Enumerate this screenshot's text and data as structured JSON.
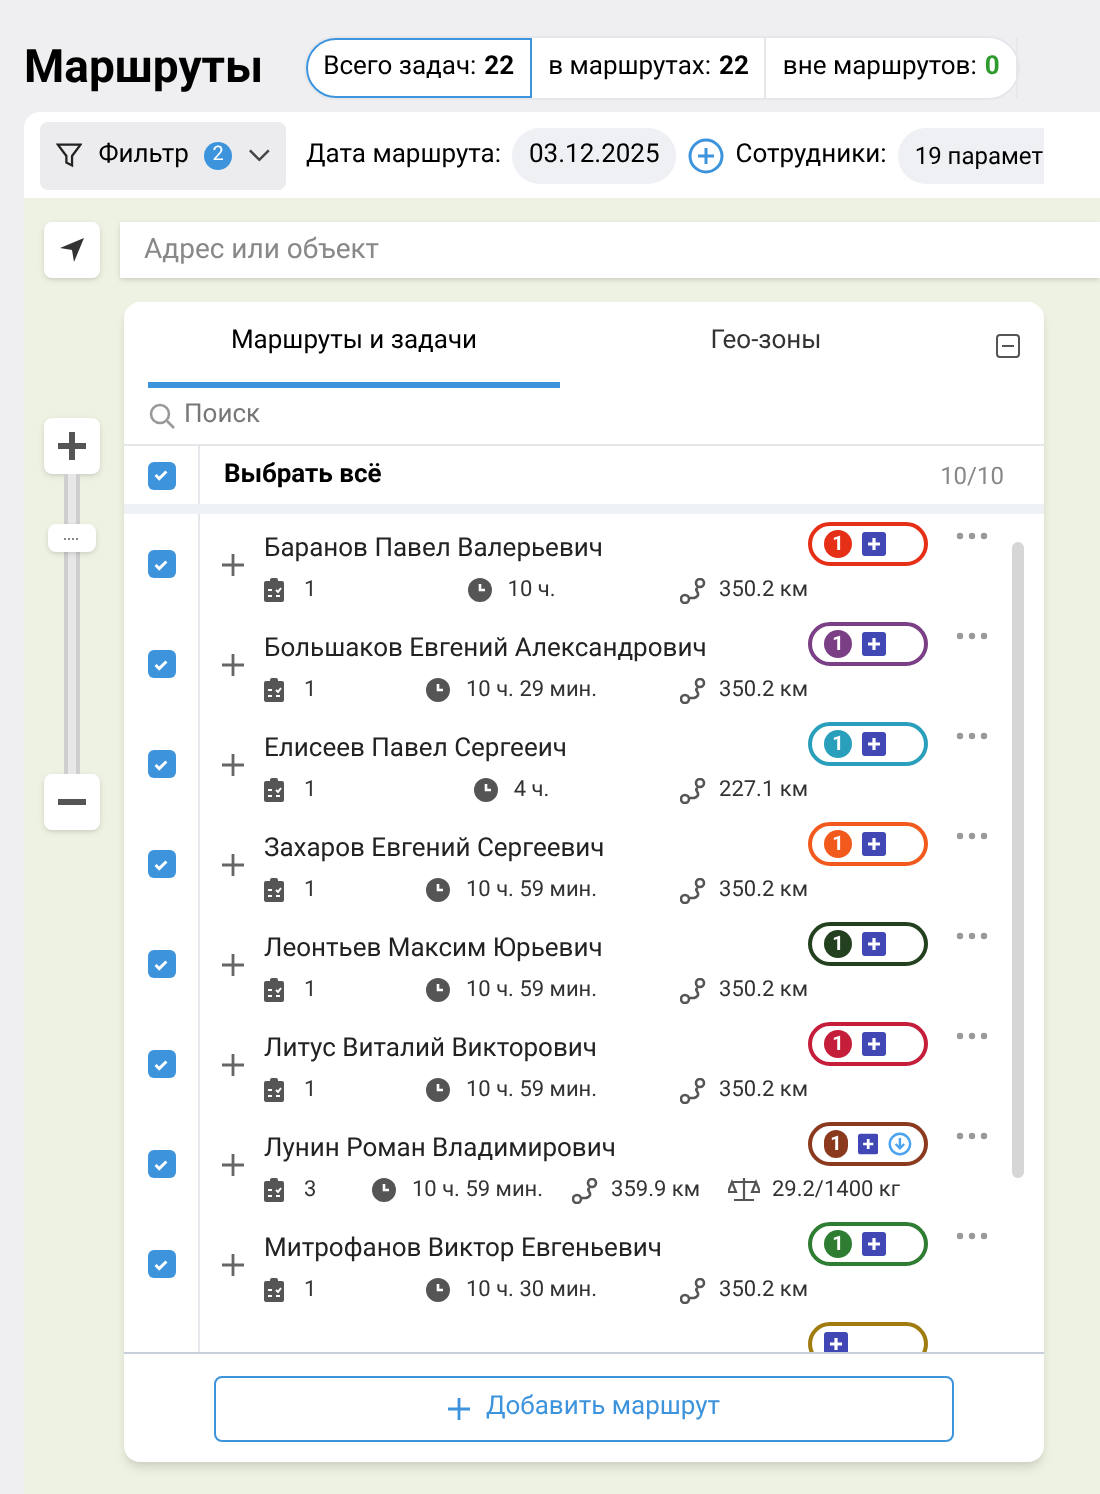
{
  "title": "Маршруты",
  "stats": [
    {
      "label": "Всего задач:",
      "value": "22",
      "selected": true,
      "kind": "plain"
    },
    {
      "label": "в маршрутах:",
      "value": "22",
      "selected": false,
      "kind": "plain"
    },
    {
      "label": "вне маршрутов:",
      "value": "0",
      "selected": false,
      "kind": "good"
    }
  ],
  "toolbar": {
    "filter": {
      "label": "Фильтр",
      "count": "2"
    },
    "date_label": "Дата маршрута:",
    "date": "03.12.2025",
    "staff_label": "Сотрудники:",
    "staff_value": "19 парамет"
  },
  "address": {
    "placeholder": "Адрес или объект"
  },
  "zoom": {
    "level": 0.8
  },
  "panel": {
    "tabs": [
      {
        "label": "Маршруты и задачи",
        "selected": true
      },
      {
        "label": "Гео-зоны",
        "selected": false
      }
    ],
    "search": {
      "placeholder": "Поиск"
    },
    "select_all": {
      "label": "Выбрать всё",
      "checked": true,
      "count": "10/10"
    },
    "routes": [
      {
        "name": "Баранов Павел Валерьевич",
        "checked": true,
        "color": "#e53017",
        "count": "1",
        "tasks": "1",
        "time": "10 ч.",
        "distance": "350.2 км"
      },
      {
        "name": "Большаков Евгений Александрович",
        "checked": true,
        "color": "#7b3f86",
        "count": "1",
        "tasks": "1",
        "time": "10 ч. 29 мин.",
        "distance": "350.2 км"
      },
      {
        "name": "Елисеев Павел Сергееич",
        "checked": true,
        "color": "#2a9fbc",
        "count": "1",
        "tasks": "1",
        "time": "4 ч.",
        "distance": "227.1 км"
      },
      {
        "name": "Захаров Евгений Сергеевич",
        "checked": true,
        "color": "#f15a1c",
        "count": "1",
        "tasks": "1",
        "time": "10 ч. 59 мин.",
        "distance": "350.2 км"
      },
      {
        "name": "Леонтьев Максим Юрьевич",
        "checked": true,
        "color": "#23401f",
        "count": "1",
        "tasks": "1",
        "time": "10 ч. 59 мин.",
        "distance": "350.2 км"
      },
      {
        "name": "Литус Виталий Викторович",
        "checked": true,
        "color": "#c41e3a",
        "count": "1",
        "tasks": "1",
        "time": "10 ч. 59 мин.",
        "distance": "350.2 км"
      },
      {
        "name": "Лунин Роман Владимирович",
        "checked": true,
        "color": "#8b3a1e",
        "count": "1",
        "download": true,
        "tasks": "3",
        "time": "10 ч. 59 мин.",
        "distance": "359.9 км",
        "weight": "29.2/1400 кг"
      },
      {
        "name": "Митрофанов Виктор Евгеньевич",
        "checked": true,
        "color": "#2e7d32",
        "count": "1",
        "tasks": "1",
        "time": "10 ч. 30 мин.",
        "distance": "350.2 км"
      },
      {
        "color": "#a07b10"
      }
    ],
    "add_button": "Добавить маршрут"
  }
}
